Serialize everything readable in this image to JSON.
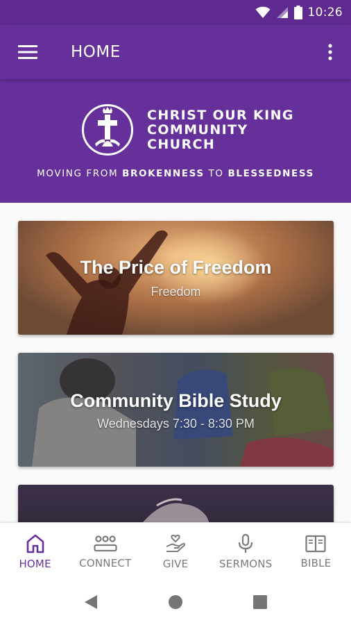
{
  "status_bar": {
    "time": "10:26"
  },
  "toolbar": {
    "title": "HOME"
  },
  "banner": {
    "logo_lines": [
      "CHRIST OUR KING",
      "COMMUNITY",
      "CHURCH"
    ],
    "tagline_parts": [
      "MOVING FROM ",
      "BROKENNESS",
      " TO ",
      "BLESSEDNESS"
    ]
  },
  "cards": [
    {
      "title": "The Price of Freedom",
      "subtitle": "Freedom"
    },
    {
      "title": "Community Bible Study",
      "subtitle": "Wednesdays 7:30 - 8:30 PM"
    },
    {
      "title": "",
      "subtitle": ""
    }
  ],
  "bottom_nav": {
    "items": [
      {
        "label": "HOME",
        "icon": "home-icon",
        "active": true
      },
      {
        "label": "CONNECT",
        "icon": "people-icon",
        "active": false
      },
      {
        "label": "GIVE",
        "icon": "heart-hand-icon",
        "active": false
      },
      {
        "label": "SERMONS",
        "icon": "microphone-icon",
        "active": false
      },
      {
        "label": "BIBLE",
        "icon": "book-icon",
        "active": false
      }
    ]
  },
  "colors": {
    "brand": "#66309b",
    "status_bar": "#5e2a8f",
    "inactive": "#7a7a7a"
  }
}
